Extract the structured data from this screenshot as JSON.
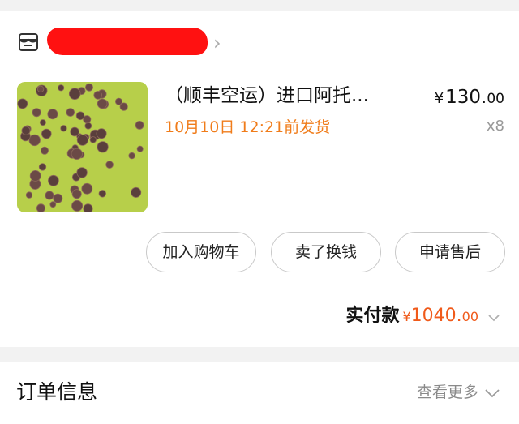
{
  "shop": {
    "name": "",
    "icon": "store-icon",
    "chevron": "›"
  },
  "product": {
    "title": "（顺丰空运）进口阿托...",
    "ship_time": "10月10日 12:21前发货",
    "price_currency": "¥",
    "price_int": "130.",
    "price_dec": "00",
    "qty": "x8"
  },
  "actions": {
    "add_cart": "加入购物车",
    "sell_swap": "卖了换钱",
    "after_sale": "申请售后"
  },
  "total": {
    "label": "实付款",
    "currency": "¥",
    "int": "1040.",
    "dec": "00"
  },
  "order_info": {
    "title": "订单信息",
    "more": "查看更多"
  },
  "colors": {
    "accent_orange": "#f07c1a",
    "price_red": "#f05a1a",
    "redaction": "#ff1111"
  }
}
